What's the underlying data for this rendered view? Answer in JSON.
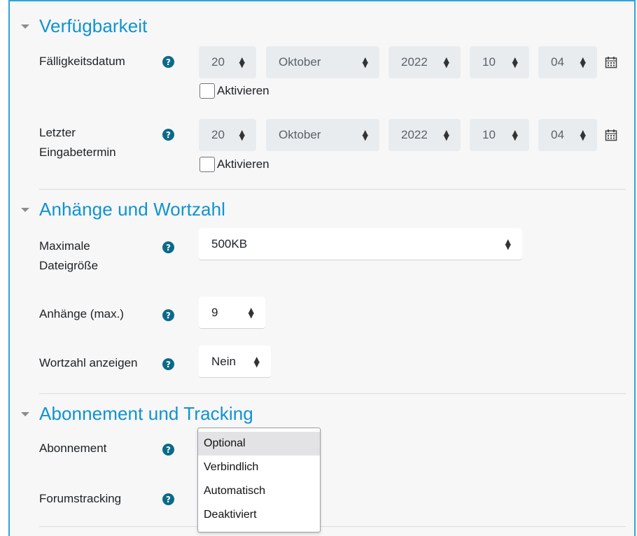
{
  "sections": [
    {
      "title": "Verfügbarkeit"
    },
    {
      "title": "Anhänge und Wortzahl"
    },
    {
      "title": "Abonnement und Tracking"
    }
  ],
  "availability": {
    "due": {
      "label": "Fälligkeitsdatum",
      "day": "20",
      "month": "Oktober",
      "year": "2022",
      "hour": "10",
      "minute": "04",
      "enable_label": "Aktivieren"
    },
    "cutoff": {
      "label_line1": "Letzter",
      "label_line2": "Eingabetermin",
      "day": "20",
      "month": "Oktober",
      "year": "2022",
      "hour": "10",
      "minute": "04",
      "enable_label": "Aktivieren"
    }
  },
  "attachments": {
    "max_size": {
      "label_line1": "Maximale",
      "label_line2": "Dateigröße",
      "value": "500KB"
    },
    "max_count": {
      "label": "Anhänge (max.)",
      "value": "9"
    },
    "word_count": {
      "label": "Wortzahl anzeigen",
      "value": "Nein"
    }
  },
  "subscription": {
    "subscription_label": "Abonnement",
    "tracking_label": "Forumstracking",
    "options": [
      "Optional",
      "Verbindlich",
      "Automatisch",
      "Deaktiviert"
    ],
    "selected": "Optional"
  },
  "icons": {
    "help": "question-circle-icon",
    "calendar": "calendar-icon",
    "collapse": "caret-down-icon",
    "select_arrows": "sort-arrows-icon"
  },
  "colors": {
    "accent": "#0f93d2",
    "help_icon": "#0b6a8a",
    "frame_border": "#2ea4d8"
  },
  "glyphs": {
    "help": "?"
  }
}
